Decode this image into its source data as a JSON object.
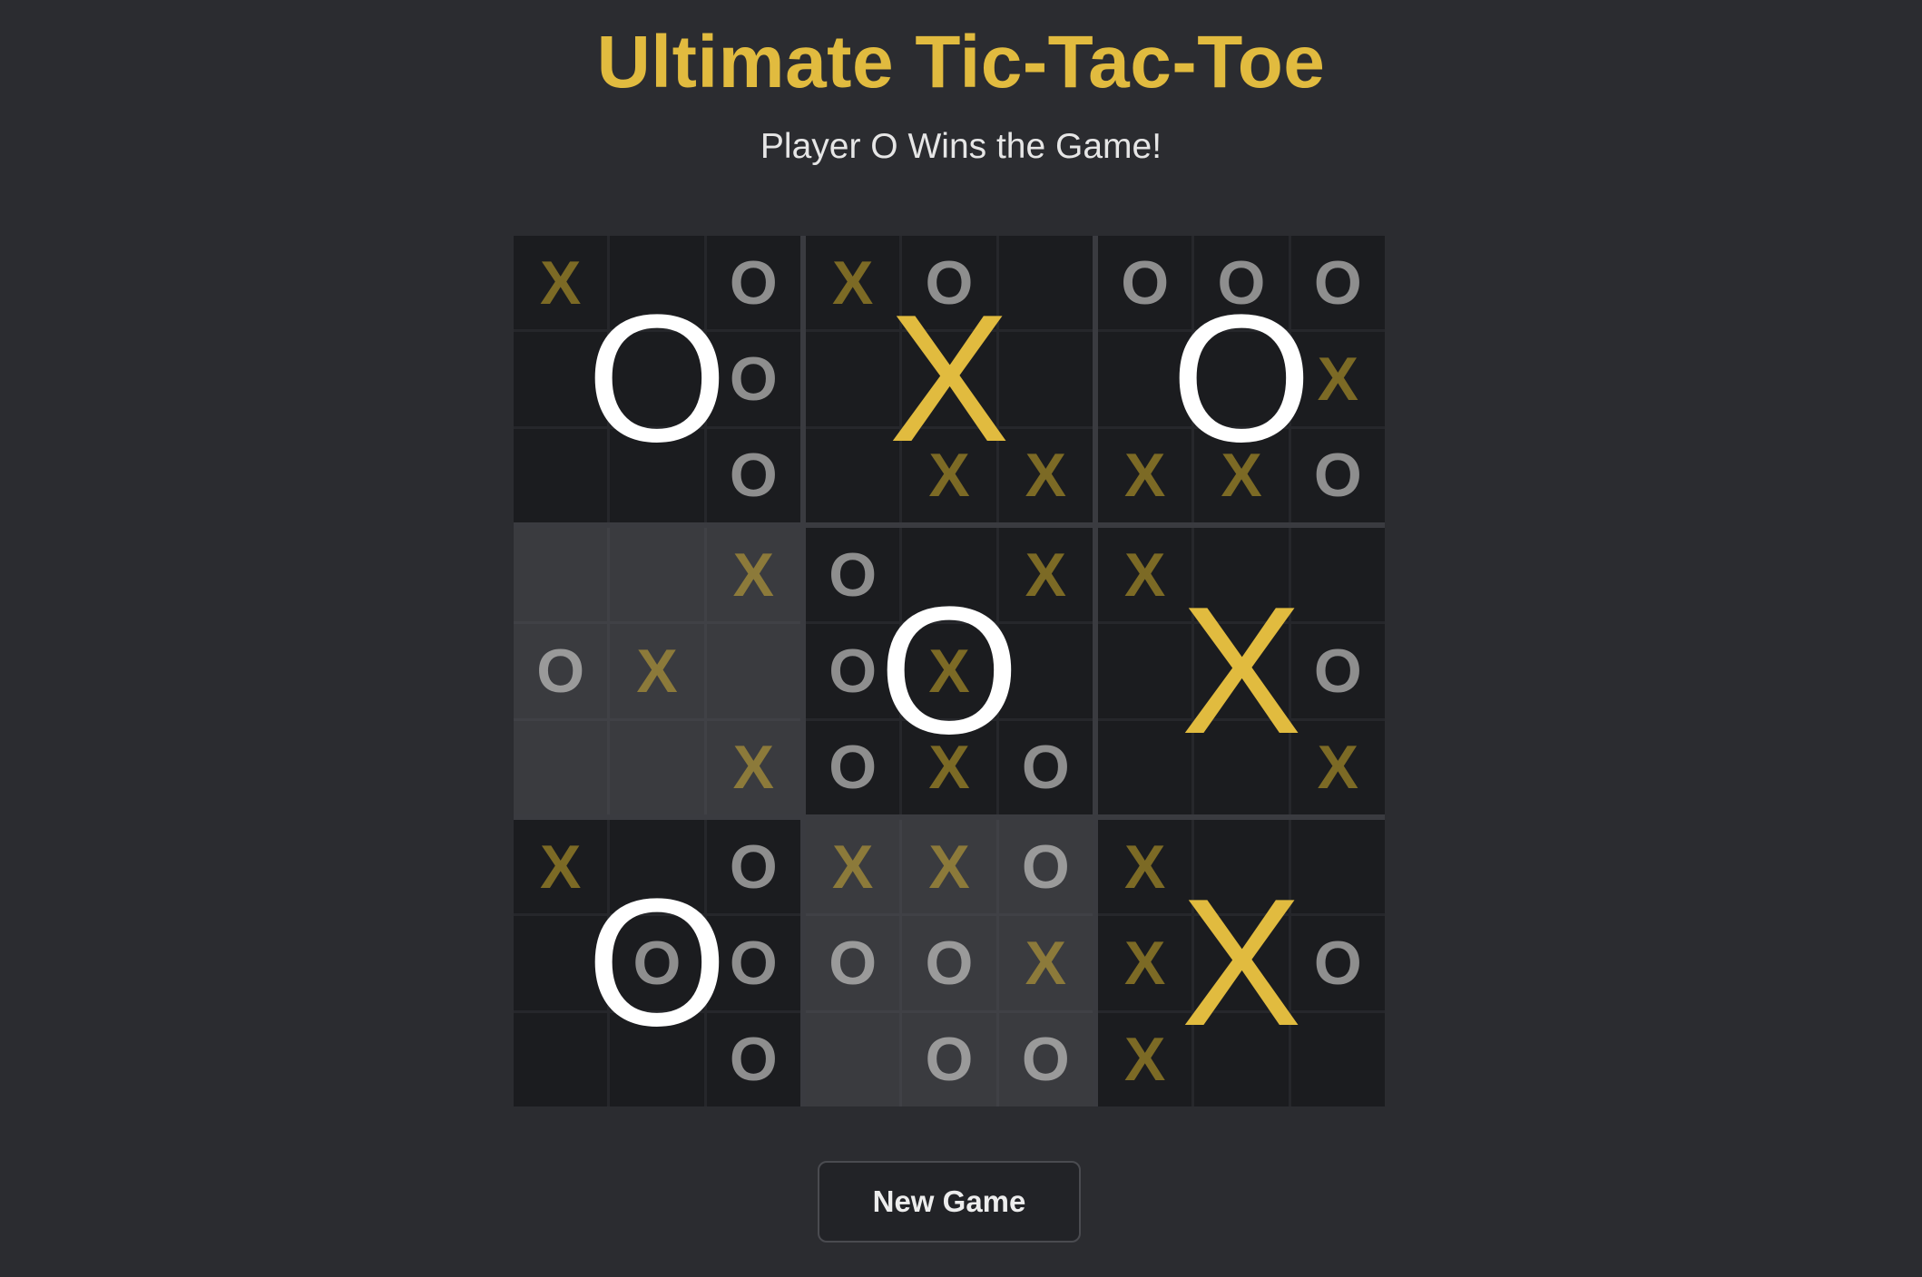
{
  "header": {
    "title": "Ultimate Tic-Tac-Toe",
    "status": "Player O Wins the Game!"
  },
  "colors": {
    "background": "#2b2c30",
    "title": "#e1bb3f",
    "x_mark": "#7c6a25",
    "o_mark": "#8e8e8e",
    "big_x": "#e1bb3f",
    "big_o": "#ffffff"
  },
  "board": {
    "subboards": [
      {
        "cells": [
          "X",
          "",
          "O",
          "",
          "",
          "O",
          "",
          "",
          "O"
        ],
        "winner": "O",
        "active": false
      },
      {
        "cells": [
          "X",
          "O",
          "",
          "",
          "",
          "",
          "",
          "X",
          "X"
        ],
        "winner": "X",
        "active": false
      },
      {
        "cells": [
          "O",
          "O",
          "O",
          "",
          "",
          "X",
          "X",
          "X",
          "O"
        ],
        "winner": "O",
        "active": false
      },
      {
        "cells": [
          "",
          "",
          "X",
          "O",
          "X",
          "",
          "",
          "",
          "X"
        ],
        "winner": "",
        "active": true
      },
      {
        "cells": [
          "O",
          "",
          "X",
          "O",
          "X",
          "",
          "O",
          "X",
          "O"
        ],
        "winner": "O",
        "active": false
      },
      {
        "cells": [
          "X",
          "",
          "",
          "",
          "",
          "O",
          "",
          "",
          "X"
        ],
        "winner": "X",
        "active": false
      },
      {
        "cells": [
          "X",
          "",
          "O",
          "",
          "O",
          "O",
          "",
          "",
          "O"
        ],
        "winner": "O",
        "active": false
      },
      {
        "cells": [
          "X",
          "X",
          "O",
          "O",
          "O",
          "X",
          "",
          "O",
          "O"
        ],
        "winner": "",
        "active": true
      },
      {
        "cells": [
          "X",
          "",
          "",
          "X",
          "",
          "O",
          "X",
          "",
          ""
        ],
        "winner": "X",
        "active": false
      }
    ]
  },
  "controls": {
    "new_game_label": "New Game"
  }
}
